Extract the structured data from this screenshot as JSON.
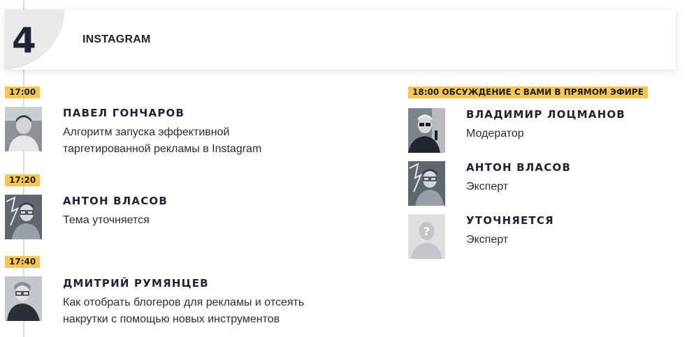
{
  "header": {
    "day_number": "4",
    "title": "INSTAGRAM"
  },
  "left_column": {
    "slots": [
      {
        "time": "17:00",
        "speaker": "ПАВЕЛ ГОНЧАРОВ",
        "topic_line1": "Алгоритм запуска эффективной",
        "topic_line2": "таргетированной рекламы в Instagram"
      },
      {
        "time": "17:20",
        "speaker": "АНТОН ВЛАСОВ",
        "topic_line1": "Тема уточняется",
        "topic_line2": ""
      },
      {
        "time": "17:40",
        "speaker": "ДМИТРИЙ РУМЯНЦЕВ",
        "topic_line1": "Как отобрать блогеров для рекламы и отсеять",
        "topic_line2": "накрутки с помощью новых инструментов"
      }
    ]
  },
  "right_column": {
    "time_label": "18:00 ОБСУЖДЕНИЕ С ВАМИ В ПРЯМОМ ЭФИРЕ",
    "panelists": [
      {
        "name": "ВЛАДИМИР ЛОЦМАНОВ",
        "role": "Модератор"
      },
      {
        "name": "АНТОН ВЛАСОВ",
        "role": "Эксперт"
      },
      {
        "name": "УТОЧНЯЕТСЯ",
        "role": "Эксперт"
      }
    ]
  },
  "colors": {
    "badge": "#f8c550",
    "text_dark": "#1f2230",
    "timeline": "#d9dadd",
    "header_circle": "#e9e9ea"
  }
}
